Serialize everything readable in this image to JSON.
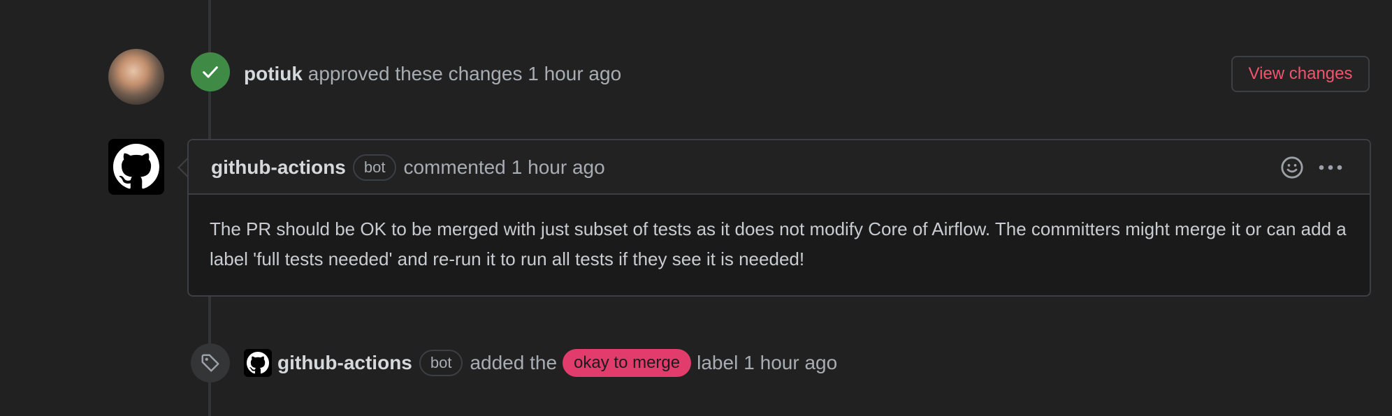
{
  "approval_event": {
    "user": "potiuk",
    "action": "approved these changes",
    "time": "1 hour ago",
    "view_changes_label": "View changes"
  },
  "comment": {
    "author": "github-actions",
    "author_badge": "bot",
    "action": "commented",
    "time": "1 hour ago",
    "body": "The PR should be OK to be merged with just subset of tests as it does not modify Core of Airflow. The committers might merge it or can add a label 'full tests needed' and re-run it to run all tests if they see it is needed!"
  },
  "label_event": {
    "author": "github-actions",
    "author_badge": "bot",
    "action_prefix": "added the",
    "label": "okay to merge",
    "action_suffix": "label",
    "time": "1 hour ago"
  },
  "colors": {
    "approve_badge": "#3f8b46",
    "view_changes_text": "#f0556c",
    "label_pill": "#e23c6d"
  },
  "icons": {
    "approve": "check-icon",
    "comment_avatar": "github-mark-icon",
    "emoji": "smiley-icon",
    "more": "kebab-horizontal-icon",
    "label_event": "tag-icon"
  }
}
